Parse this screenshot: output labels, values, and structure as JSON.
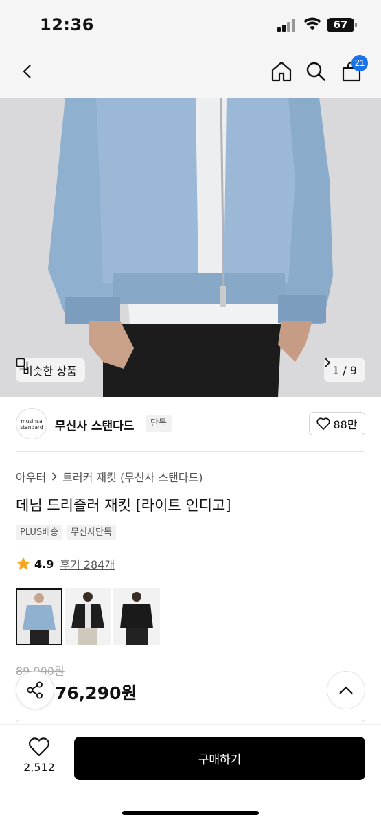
{
  "status_bar": {
    "time": "12:36",
    "battery": "67"
  },
  "nav": {
    "cart_count": "21"
  },
  "hero": {
    "similar_label": "비슷한 상품",
    "counter": "1 / 9"
  },
  "brand": {
    "logo_line1": "musinsa",
    "logo_line2": "standard",
    "name": "무신사 스탠다드",
    "tag": "단독",
    "likes": "88만"
  },
  "breadcrumb": {
    "category": "아우터",
    "subcategory": "트러커 재킷 (무신사 스탠다드)"
  },
  "product": {
    "title": "데님 드리즐러 재킷 [라이트 인디고]",
    "tags": [
      "PLUS배송",
      "무신사단독"
    ],
    "rating": "4.9",
    "reviews": "후기 284개",
    "colors": [
      "light-indigo",
      "black-open",
      "black-closed"
    ],
    "original_price": "89,900원",
    "sale_price": "76,290원"
  },
  "bottom_bar": {
    "wish_count": "2,512",
    "buy_label": "구매하기"
  },
  "colors": {
    "accent_badge": "#1a73e8",
    "star": "#f5a623",
    "buy_button": "#000000"
  }
}
